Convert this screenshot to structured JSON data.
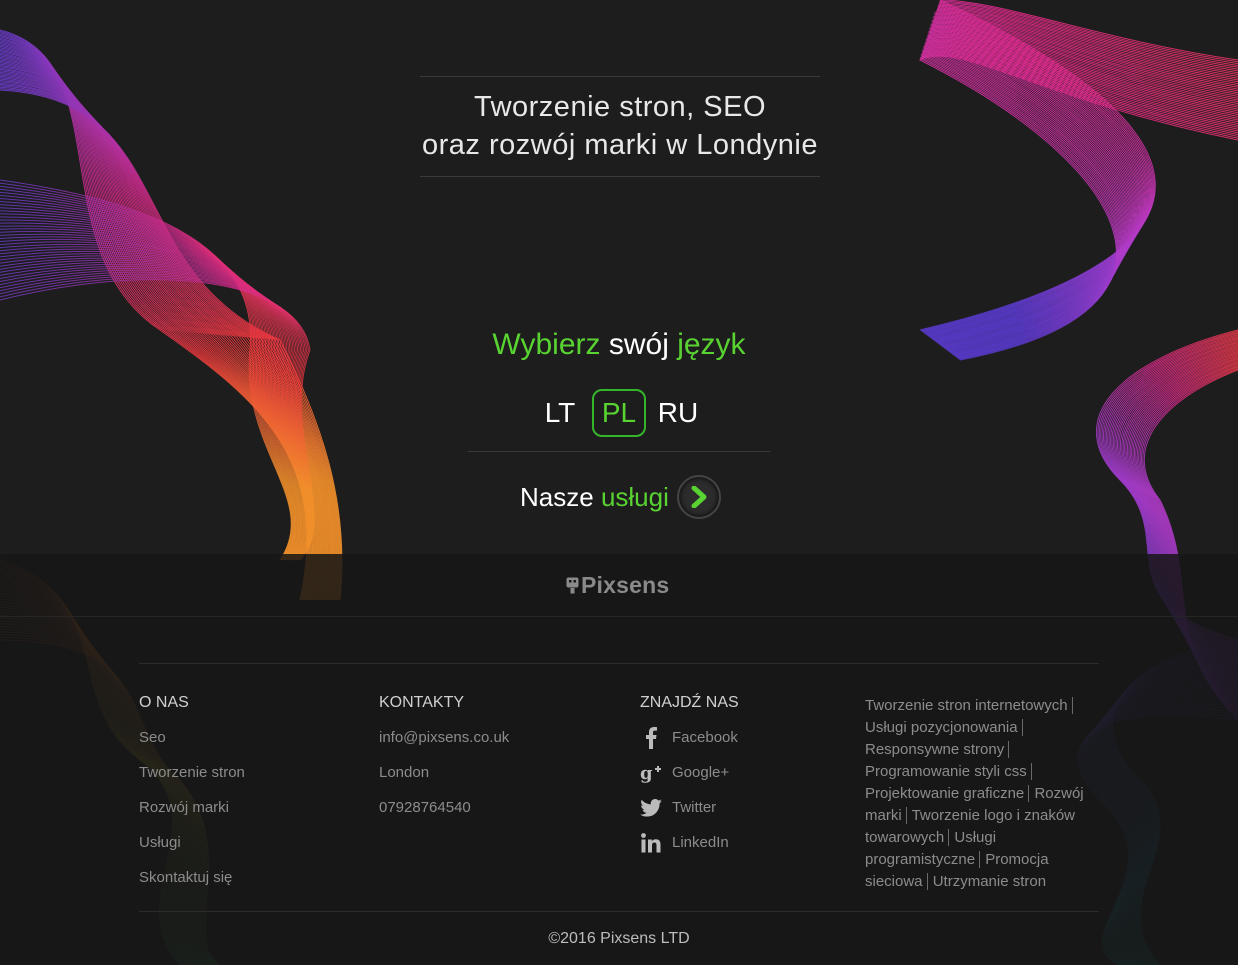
{
  "hero": {
    "tagline_line1": "Tworzenie stron, SEO",
    "tagline_line2": "oraz rozwój marki w Londynie",
    "choose_word1": "Wybierz",
    "choose_word2": "swój",
    "choose_word3": "język",
    "languages": [
      {
        "code": "LT",
        "active": false
      },
      {
        "code": "PL",
        "active": true
      },
      {
        "code": "RU",
        "active": false
      }
    ],
    "services_prefix": "Nasze",
    "services_highlight": "usługi",
    "services_button_icon": "chevron-right-icon"
  },
  "footer": {
    "logo_text": "Pixsens",
    "about": {
      "heading": "O NAS",
      "items": [
        "Seo",
        "Tworzenie stron",
        "Rozwój marki",
        "Usługi",
        "Skontaktuj się"
      ]
    },
    "contacts": {
      "heading": "KONTAKTY",
      "items": [
        "info@pixsens.co.uk",
        "London",
        "07928764540"
      ]
    },
    "find_us": {
      "heading": "ZNAJDŹ NAS",
      "items": [
        {
          "label": "Facebook",
          "icon": "facebook-icon"
        },
        {
          "label": "Google+",
          "icon": "google-plus-icon"
        },
        {
          "label": "Twitter",
          "icon": "twitter-icon"
        },
        {
          "label": "LinkedIn",
          "icon": "linkedin-icon"
        }
      ]
    },
    "seo_links": [
      "Tworzenie stron internetowych",
      "Usługi pozycjonowania",
      "Responsywne strony",
      "Programowanie styli css",
      "Projektowanie graficzne",
      "Rozwój marki",
      "Tworzenie logo i znaków towarowych",
      "Usługi programistyczne",
      "Promocja sieciowa",
      "Utrzymanie stron"
    ],
    "copyright": "©2016 Pixsens LTD"
  },
  "colors": {
    "accent_green": "#59d332",
    "background": "#1d1d1d",
    "wave_magenta": "#e0287c",
    "wave_orange": "#f07a2a",
    "wave_purple": "#7a3cc8"
  }
}
